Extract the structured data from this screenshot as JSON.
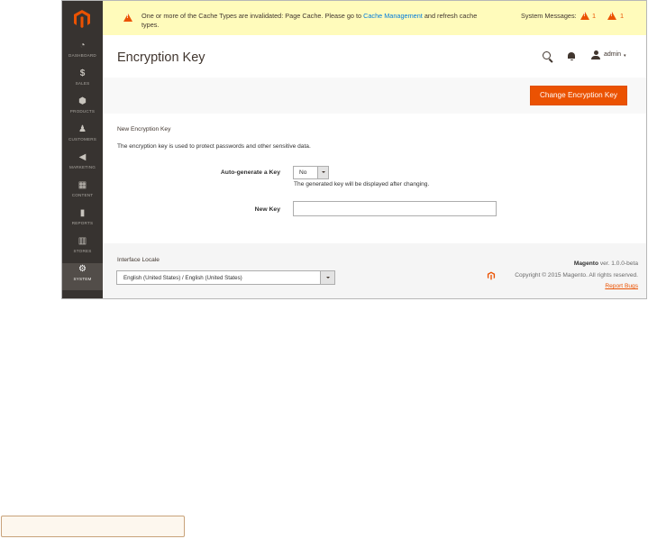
{
  "sidebar": {
    "items": [
      {
        "label": "DASHBOARD",
        "icon": "dashboard-icon"
      },
      {
        "label": "SALES",
        "icon": "dollar-icon"
      },
      {
        "label": "PRODUCTS",
        "icon": "cube-icon"
      },
      {
        "label": "CUSTOMERS",
        "icon": "person-icon"
      },
      {
        "label": "MARKETING",
        "icon": "megaphone-icon"
      },
      {
        "label": "CONTENT",
        "icon": "content-icon"
      },
      {
        "label": "REPORTS",
        "icon": "bar-chart-icon"
      },
      {
        "label": "STORES",
        "icon": "store-icon"
      },
      {
        "label": "SYSTEM",
        "icon": "gear-icon"
      }
    ]
  },
  "system_message": {
    "text_before": "One or more of the Cache Types are invalidated: Page Cache. Please go to ",
    "link": "Cache Management",
    "text_after": " and refresh cache types.",
    "label": "System Messages:",
    "count_major": "1",
    "count_critical": "1"
  },
  "header": {
    "title": "Encryption Key",
    "user": "admin",
    "caret": "▾"
  },
  "actions": {
    "primary": "Change Encryption Key"
  },
  "form": {
    "section_title": "New Encryption Key",
    "section_note": "The encryption key is used to protect passwords and other sensitive data.",
    "auto_label": "Auto-generate a Key",
    "auto_value": "No",
    "auto_note": "The generated key will be displayed after changing.",
    "new_key_label": "New Key",
    "new_key_value": ""
  },
  "footer": {
    "locale_label": "Interface Locale",
    "locale_value": "English (United States) / English (United States)",
    "brand": "Magento",
    "version": " ver. 1.0.0-beta",
    "copyright": "Copyright © 2015 Magento. All rights reserved.",
    "report": "Report Bugs"
  },
  "colors": {
    "accent": "#eb5202",
    "sidebar": "#373330",
    "message_bg": "#fffbbb",
    "link": "#007bdb"
  }
}
